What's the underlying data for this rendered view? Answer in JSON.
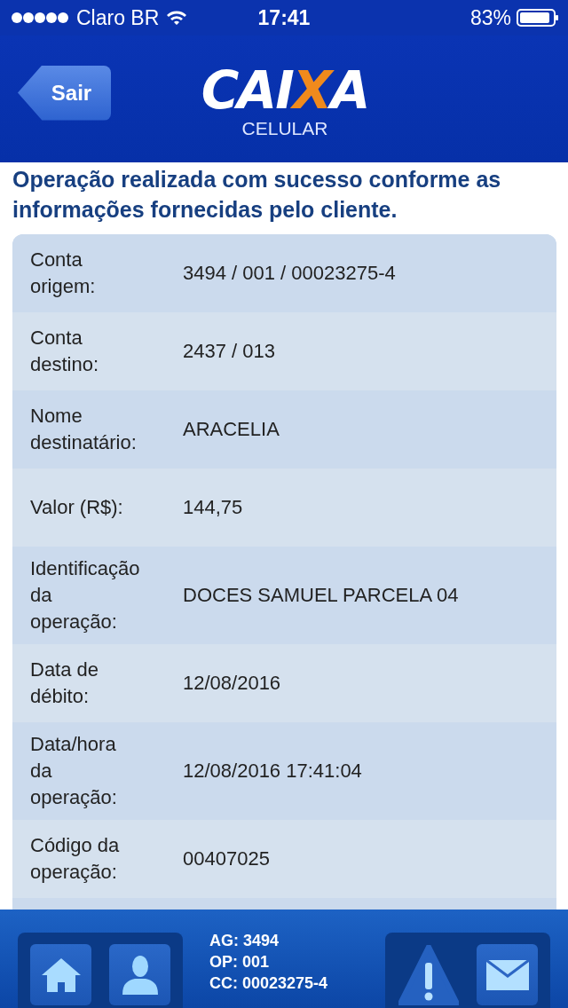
{
  "status_bar": {
    "carrier": "Claro BR",
    "time": "17:41",
    "battery": "83%"
  },
  "header": {
    "back_button": "Sair",
    "logo": [
      {
        "text": "CAI",
        "accent": false
      },
      {
        "text": "X",
        "accent": true
      },
      {
        "text": "A",
        "accent": false
      }
    ],
    "subtitle": "CELULAR"
  },
  "message": "Operação realizada com sucesso conforme as informações fornecidas pelo cliente.",
  "details": [
    {
      "label": "Conta\norigem:",
      "value": "3494 / 001 / 00023275-4"
    },
    {
      "label": "Conta\ndestino:",
      "value": "2437 / 013"
    },
    {
      "label": "Nome\ndestinatário:",
      "value": "ARACELIA"
    },
    {
      "label": "Valor (R$):",
      "value": "144,75"
    },
    {
      "label": "Identificação\nda\noperação:",
      "value": "DOCES SAMUEL PARCELA 04"
    },
    {
      "label": "Data de\ndébito:",
      "value": "12/08/2016"
    },
    {
      "label": "Data/hora\nda\noperação:",
      "value": "12/08/2016 17:41:04"
    },
    {
      "label": "Código da\noperação:",
      "value": "00407025"
    }
  ],
  "footer": {
    "account": [
      "AG: 3494",
      "OP: 001",
      "CC: 00023275-4"
    ]
  }
}
